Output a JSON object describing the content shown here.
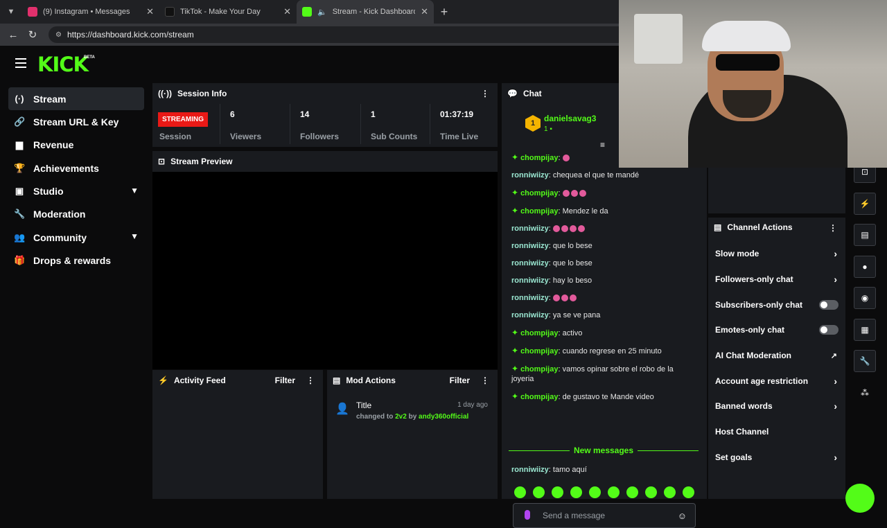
{
  "browser": {
    "tabs": [
      {
        "title": "(9) Instagram • Messages",
        "color": "#e1306c"
      },
      {
        "title": "TikTok - Make Your Day",
        "color": "#111111"
      },
      {
        "title": "Stream - Kick Dashboard",
        "color": "#53fc18"
      }
    ],
    "url": "https://dashboard.kick.com/stream"
  },
  "app": {
    "logo": "KICK",
    "beta": "BETA",
    "accent": "#53fc18"
  },
  "sidebar": {
    "items": [
      {
        "label": "Stream",
        "icon": "stream-icon"
      },
      {
        "label": "Stream URL & Key",
        "icon": "link-icon"
      },
      {
        "label": "Revenue",
        "icon": "revenue-icon"
      },
      {
        "label": "Achievements",
        "icon": "trophy-icon"
      },
      {
        "label": "Studio",
        "icon": "studio-icon"
      },
      {
        "label": "Moderation",
        "icon": "wrench-icon"
      },
      {
        "label": "Community",
        "icon": "community-icon"
      },
      {
        "label": "Drops & rewards",
        "icon": "gift-icon"
      }
    ]
  },
  "session": {
    "title": "Session Info",
    "status": "STREAMING",
    "status_label": "Session",
    "stats": [
      {
        "value": "6",
        "label": "Viewers"
      },
      {
        "value": "14",
        "label": "Followers"
      },
      {
        "value": "1",
        "label": "Sub Counts"
      },
      {
        "value": "01:37:19",
        "label": "Time Live"
      }
    ]
  },
  "preview": {
    "title": "Stream Preview"
  },
  "activity": {
    "title": "Activity Feed",
    "filter": "Filter"
  },
  "mod": {
    "title": "Mod Actions",
    "filter": "Filter",
    "entry": {
      "title": "Title",
      "time": "1 day ago",
      "text": "changed to",
      "value": "2v2",
      "by": "by",
      "user": "andy360official"
    }
  },
  "chat": {
    "title": "Chat",
    "top_user": {
      "rank": "1",
      "name": "danielsavag3",
      "count": "1"
    },
    "messages": [
      {
        "user": "chompijay",
        "text": "",
        "emotes": 1,
        "star": true
      },
      {
        "user": "ronniwiizy",
        "text": "chequea el que te mandé",
        "emotes": 0,
        "star": false
      },
      {
        "user": "chompijay",
        "text": "",
        "emotes": 3,
        "star": true
      },
      {
        "user": "chompijay",
        "text": "Mendez le da",
        "emotes": 0,
        "star": true
      },
      {
        "user": "ronniwiizy",
        "text": "",
        "emotes": 4,
        "star": false
      },
      {
        "user": "ronniwiizy",
        "text": "que lo bese",
        "emotes": 0,
        "star": false
      },
      {
        "user": "ronniwiizy",
        "text": "que lo bese",
        "emotes": 0,
        "star": false
      },
      {
        "user": "ronniwiizy",
        "text": "hay lo beso",
        "emotes": 0,
        "star": false
      },
      {
        "user": "ronniwiizy",
        "text": "",
        "emotes": 3,
        "star": false
      },
      {
        "user": "ronniwiizy",
        "text": "ya se ve pana",
        "emotes": 0,
        "star": false
      },
      {
        "user": "chompijay",
        "text": "activo",
        "emotes": 0,
        "star": true
      },
      {
        "user": "chompijay",
        "text": "cuando regrese en 25 minuto",
        "emotes": 0,
        "star": true
      },
      {
        "user": "chompijay",
        "text": "vamos opinar sobre el robo de la joyeria",
        "emotes": 0,
        "star": true
      },
      {
        "user": "chompijay",
        "text": "de gustavo te Mande video",
        "emotes": 0,
        "star": true
      }
    ],
    "new_messages": "New messages",
    "last": {
      "user": "ronniwiizy",
      "text": "tamo aquí"
    },
    "placeholder": "Send a message"
  },
  "channel_actions": {
    "title": "Channel Actions",
    "items": [
      {
        "label": "Slow mode",
        "type": "arrow"
      },
      {
        "label": "Followers-only chat",
        "type": "arrow"
      },
      {
        "label": "Subscribers-only chat",
        "type": "toggle"
      },
      {
        "label": "Emotes-only chat",
        "type": "toggle"
      },
      {
        "label": "AI Chat Moderation",
        "type": "external"
      },
      {
        "label": "Account age restriction",
        "type": "arrow"
      },
      {
        "label": "Banned words",
        "type": "arrow"
      },
      {
        "label": "Host Channel",
        "type": "none"
      },
      {
        "label": "Set goals",
        "type": "arrow"
      }
    ]
  }
}
